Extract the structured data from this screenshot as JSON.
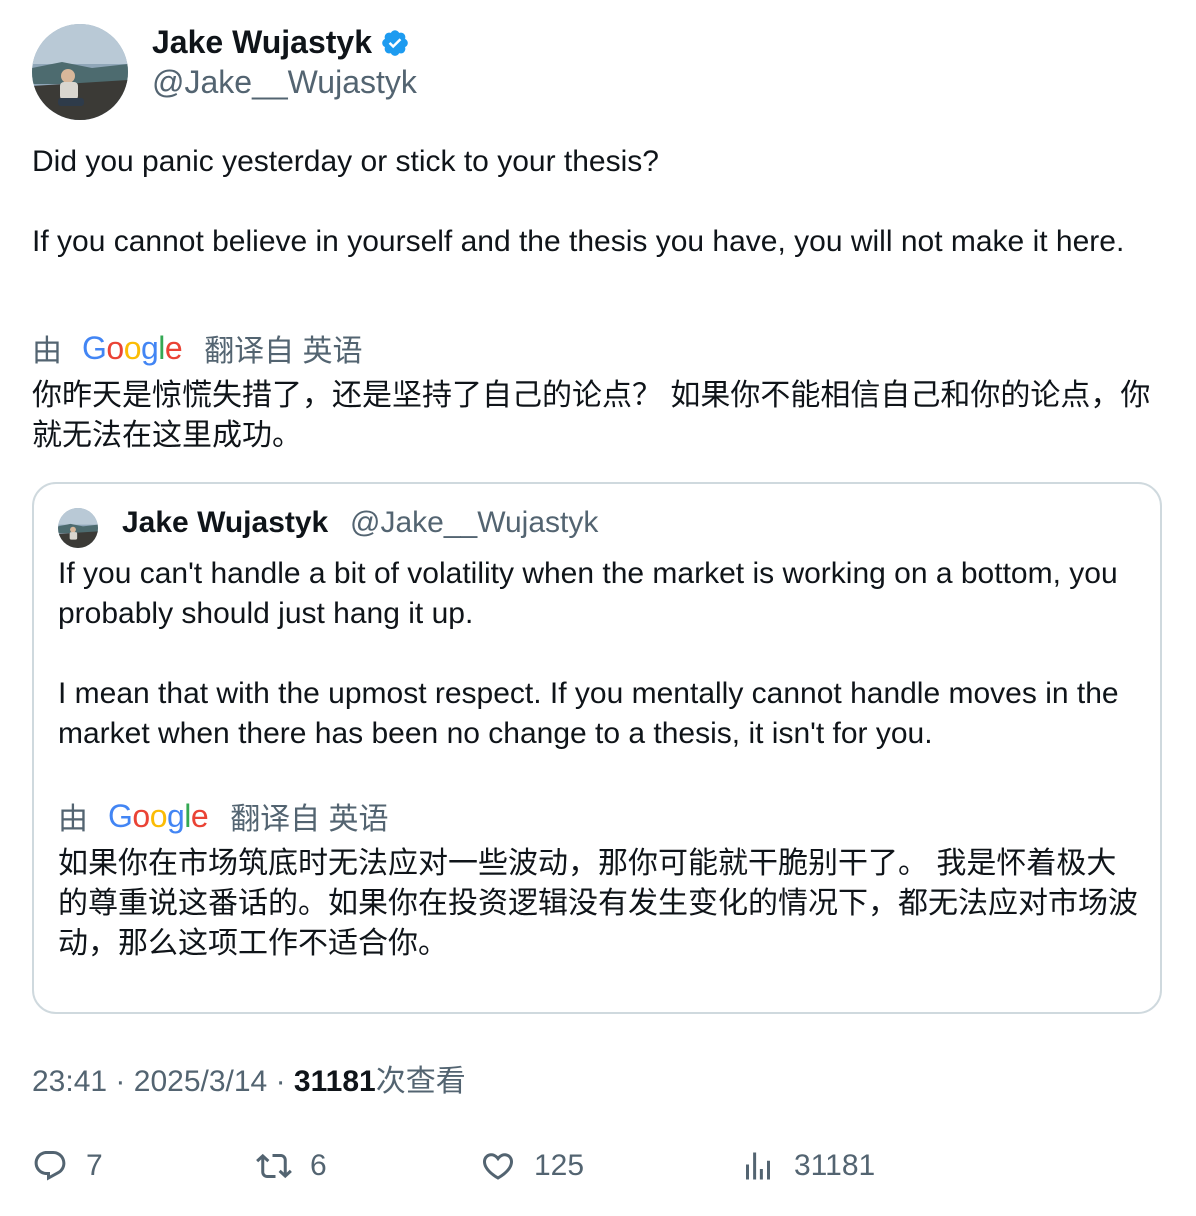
{
  "author": {
    "name": "Jake Wujastyk",
    "handle": "@Jake__Wujastyk",
    "verified": true
  },
  "tweet": {
    "line1": "Did you panic yesterday or stick to your thesis?",
    "line2": "If you cannot believe in yourself and the thesis you have, you will not make it here.",
    "translation": {
      "by_label": "由",
      "provider": "Google",
      "from_label": "翻译自 英语",
      "text": "你昨天是惊慌失措了，还是坚持了自己的论点？ 如果你不能相信自己和你的论点，你就无法在这里成功。"
    }
  },
  "quote": {
    "name": "Jake Wujastyk",
    "handle": "@Jake__Wujastyk",
    "line1": "If you can't handle a bit of volatility when the market is working on a bottom, you probably should just hang it up.",
    "line2": "I mean that with the upmost respect. If you mentally cannot handle moves in the market when there has been no change to a thesis, it isn't for you.",
    "translation": {
      "by_label": "由",
      "provider": "Google",
      "from_label": "翻译自 英语",
      "text": "如果你在市场筑底时无法应对一些波动，那你可能就干脆别干了。 我是怀着极大的尊重说这番话的。如果你在投资逻辑没有发生变化的情况下，都无法应对市场波动，那么这项工作不适合你。"
    }
  },
  "meta": {
    "time": "23:41",
    "sep": "·",
    "date": "2025/3/14",
    "views": "31181",
    "views_label": "次查看"
  },
  "actions": {
    "replies": "7",
    "reposts": "6",
    "likes": "125",
    "views": "31181"
  },
  "colors": {
    "verified": "#1d9bf0",
    "muted": "#536471",
    "border": "#cfd9de"
  },
  "icons": [
    "verified-badge-icon",
    "reply-icon",
    "repost-icon",
    "like-icon",
    "views-icon"
  ]
}
